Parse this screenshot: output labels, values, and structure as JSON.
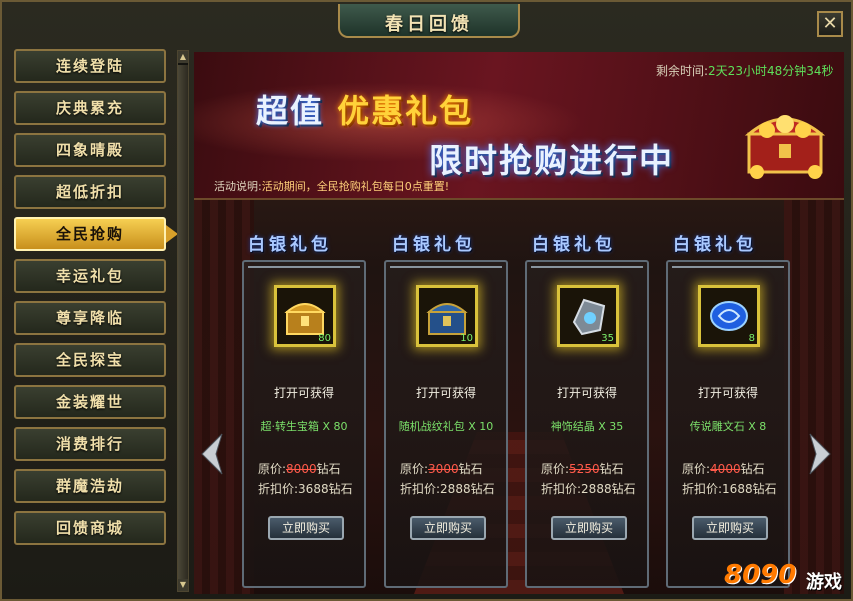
{
  "window": {
    "title": "春日回馈",
    "close_label": "✕"
  },
  "sidebar": {
    "items": [
      {
        "label": "连续登陆"
      },
      {
        "label": "庆典累充"
      },
      {
        "label": "四象晴殿"
      },
      {
        "label": "超低折扣"
      },
      {
        "label": "全民抢购",
        "active": true
      },
      {
        "label": "幸运礼包"
      },
      {
        "label": "尊享降临"
      },
      {
        "label": "全民探宝"
      },
      {
        "label": "金装耀世"
      },
      {
        "label": "消费排行"
      },
      {
        "label": "群魔浩劫"
      },
      {
        "label": "回馈商城"
      }
    ]
  },
  "banner": {
    "line1_a": "超值",
    "line1_b": "优惠礼包",
    "line2": "限时抢购进行中",
    "timer_label": "剩余时间:",
    "timer_value": "2天23小时48分钟34秒",
    "desc_label": "活动说明:",
    "desc_value": "活动期间，全民抢购礼包每日0点重置!"
  },
  "packs": [
    {
      "title": "白银礼包",
      "qty": "80",
      "open_text": "打开可获得",
      "item": "超·转生宝箱 X 80",
      "orig_label": "原价:",
      "orig_price": "8000",
      "orig_unit": "钻石",
      "disc_label": "折扣价:",
      "disc_price": "3688钻石",
      "buy": "立即购买",
      "icon": "treasure-chest-icon"
    },
    {
      "title": "白银礼包",
      "qty": "10",
      "open_text": "打开可获得",
      "item": "随机战纹礼包 X 10",
      "orig_label": "原价:",
      "orig_price": "3000",
      "orig_unit": "钻石",
      "disc_label": "折扣价:",
      "disc_price": "2888钻石",
      "buy": "立即购买",
      "icon": "blue-chest-icon"
    },
    {
      "title": "白银礼包",
      "qty": "35",
      "open_text": "打开可获得",
      "item": "神饰结晶 X 35",
      "orig_label": "原价:",
      "orig_price": "5250",
      "orig_unit": "钻石",
      "disc_label": "折扣价:",
      "disc_price": "2888钻石",
      "buy": "立即购买",
      "icon": "crystal-icon"
    },
    {
      "title": "白银礼包",
      "qty": "8",
      "open_text": "打开可获得",
      "item": "传说雕文石 X 8",
      "orig_label": "原价:",
      "orig_price": "4000",
      "orig_unit": "钻石",
      "disc_label": "折扣价:",
      "disc_price": "1688钻石",
      "buy": "立即购买",
      "icon": "rune-stone-icon"
    }
  ],
  "watermark": {
    "num": "8090",
    "text": "游戏"
  },
  "colors": {
    "accent_gold": "#d9a12a",
    "timer_green": "#5ee05a",
    "strike_red": "#ff5a4a",
    "item_green": "#7be06a"
  }
}
